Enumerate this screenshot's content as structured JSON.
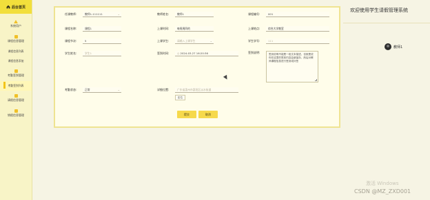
{
  "sidebar": {
    "logo": "后台首页",
    "items": [
      {
        "label": "系统用户",
        "icon": "user-icon"
      },
      {
        "label": "课程信息管理",
        "icon": "course-icon"
      },
      {
        "label": "课程信息列表",
        "sub": true
      },
      {
        "label": "课程信息添加",
        "sub": true
      },
      {
        "label": "考勤签到管理",
        "icon": "checkin-icon"
      },
      {
        "label": "考勤签到列表",
        "sub": true,
        "active": true
      },
      {
        "label": "请假信息管理",
        "icon": "leave-icon"
      },
      {
        "label": "销假信息管理",
        "icon": "cancel-leave-icon"
      }
    ]
  },
  "form": {
    "teacher_no": {
      "label": "任课教师:",
      "value": "教师1-111111"
    },
    "teacher_name": {
      "label": "教师姓名:",
      "value": "教师1"
    },
    "course_no": {
      "label": "课程编号:",
      "value": "001"
    },
    "course_name": {
      "label": "课程名称:",
      "value": "课程1"
    },
    "class_time": {
      "label": "上课时间:",
      "value": "每周周四的"
    },
    "class_place": {
      "label": "上课地点:",
      "value": "综合大学教室"
    },
    "lessons": {
      "label": "课程节次:",
      "value": "5"
    },
    "class_student": {
      "label": "上课学生:",
      "value": "请输入上课学生"
    },
    "student_no": {
      "label": "学生学号:",
      "value": "111"
    },
    "student_name": {
      "label": "学生姓名:",
      "value": "学生1"
    },
    "checkin_time": {
      "label": "签到时间:",
      "value": "2024-03-27 16:20:36"
    },
    "checkin_note": {
      "label": "签到说明:",
      "value": "签到说明不能是一段文本描述，也就是说你在这里的签到内容会被保存，然后对教师课程信息进行签到或补签"
    },
    "status": {
      "label": "考勤状态:",
      "value": "正常"
    },
    "location": {
      "label": "详细位置:",
      "value": "广东省惠州市惠阳区淡水街道"
    },
    "locate_btn": "定位",
    "submit": "提交",
    "cancel": "取消"
  },
  "welcome": "欢迎使用学生请假管理系统",
  "user": "教师1",
  "watermark": "激活 Windows",
  "csdn": "CSDN @MZ_ZXD001"
}
